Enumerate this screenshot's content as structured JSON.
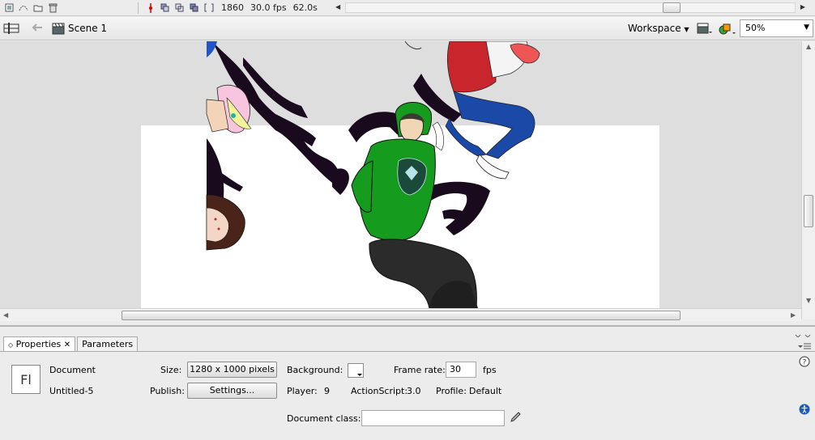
{
  "timeline": {
    "frame": "1860",
    "fps": "30.0 fps",
    "time": "62.0s",
    "icons": [
      "new-layer-icon",
      "motion-guide-icon",
      "new-folder-icon",
      "delete-icon",
      "playhead-icon",
      "onion-skin-icon",
      "onion-skin-outlines-icon",
      "edit-multiple-frames-icon",
      "onion-markers-icon"
    ]
  },
  "editbar": {
    "scene": "Scene 1",
    "workspace": "Workspace",
    "zoom": "50%"
  },
  "panel": {
    "tabs": [
      {
        "label": "Properties",
        "active": true
      },
      {
        "label": "Parameters",
        "active": false
      }
    ],
    "doc_icon_text": "Fl",
    "doc_type": "Document",
    "doc_name": "Untitled-5",
    "size_label": "Size:",
    "size_value": "1280 x 1000 pixels",
    "publish_label": "Publish:",
    "settings_button": "Settings...",
    "background_label": "Background:",
    "background_color": "#ffffff",
    "frame_rate_label": "Frame rate:",
    "frame_rate": "30",
    "fps_unit": "fps",
    "player_label": "Player:",
    "player_value": "9",
    "actionscript_label": "ActionScript:",
    "actionscript_value": "3.0",
    "profile_label": "Profile:",
    "profile_value": "Default",
    "document_class_label": "Document class:",
    "document_class_value": ""
  }
}
